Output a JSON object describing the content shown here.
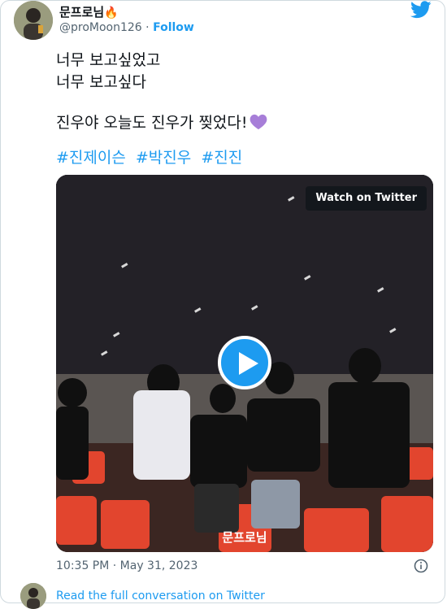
{
  "author": {
    "display_name": "문프로님",
    "display_emoji": "🔥",
    "handle": "@proMoon126",
    "separator": "·",
    "follow_label": "Follow"
  },
  "tweet": {
    "lines": [
      "너무 보고싶었고",
      "너무 보고싶다"
    ],
    "line3": "진우야 오늘도 진우가 찢었다!",
    "hashtags": [
      "#진제이슨",
      "#박진우",
      "#진진"
    ]
  },
  "video": {
    "watch_label": "Watch on Twitter",
    "watermark": "문프로님"
  },
  "footer": {
    "timestamp": "10:35 PM · May 31, 2023",
    "read_more": "Read the full conversation on Twitter"
  },
  "colors": {
    "accent": "#1d9bf0",
    "heart": "#a77ed8",
    "text": "#0f1419",
    "muted": "#536471"
  },
  "icons": {
    "brand": "twitter-bird-icon",
    "play": "play-icon",
    "info": "info-icon",
    "heart": "purple-heart-icon"
  }
}
